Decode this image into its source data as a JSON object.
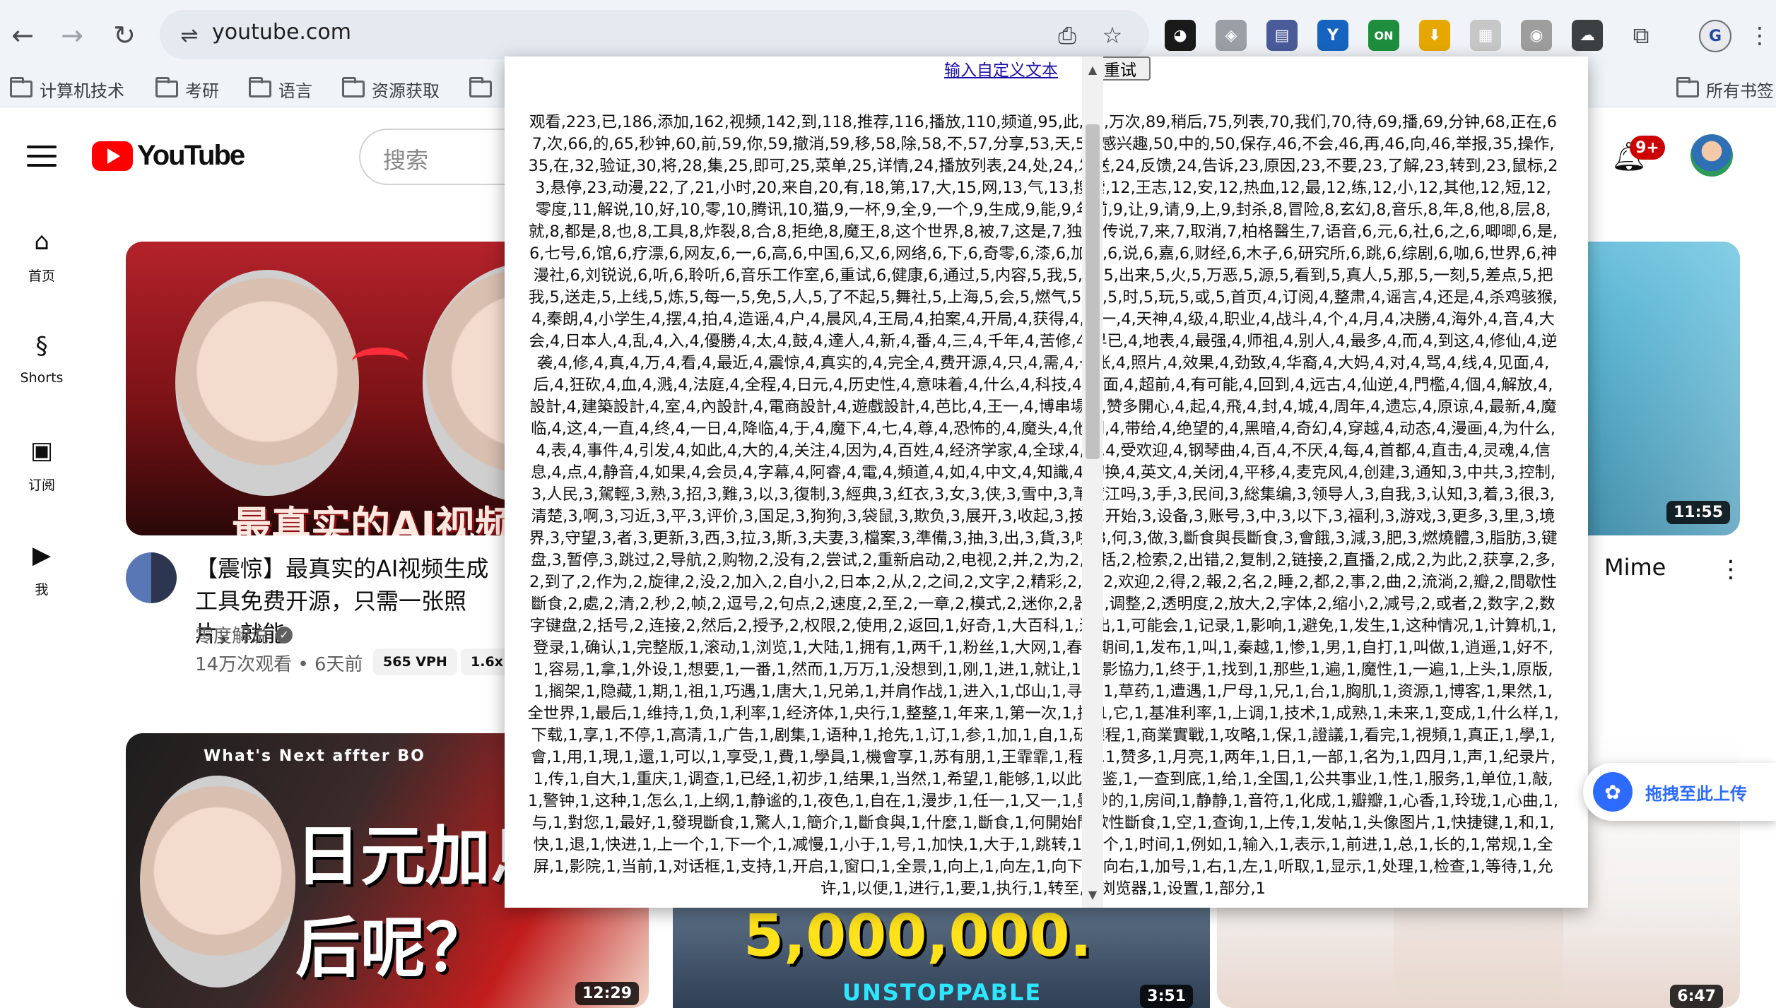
{
  "browser": {
    "url": "youtube.com",
    "bookmarks": [
      "计算机技术",
      "考研",
      "语言",
      "资源获取",
      "",
      "所有书签"
    ],
    "profile_initial": "G",
    "icons": {
      "back": "←",
      "forward": "→",
      "reload": "↻",
      "site_settings": "⇌",
      "install": "⎙",
      "star": "☆",
      "extensions": "⧉",
      "more": "⋮"
    },
    "extensions": [
      {
        "name": "ext-mask",
        "glyph": "◕",
        "color": "#1a1a1a"
      },
      {
        "name": "ext-shield",
        "glyph": "◈",
        "color": "#9aa0a6"
      },
      {
        "name": "ext-window",
        "glyph": "▤",
        "color": "#4a5b9a"
      },
      {
        "name": "ext-y",
        "glyph": "Y",
        "color": "#1664c0"
      },
      {
        "name": "ext-on",
        "glyph": "ON",
        "color": "#1e8e3e"
      },
      {
        "name": "ext-download",
        "glyph": "⬇",
        "color": "#e6a800"
      },
      {
        "name": "ext-grid",
        "glyph": "▦",
        "color": "#c7c7c7"
      },
      {
        "name": "ext-camera",
        "glyph": "◉",
        "color": "#9e9e9e"
      },
      {
        "name": "ext-cloud",
        "glyph": "☁",
        "color": "#3c4043"
      }
    ]
  },
  "youtube": {
    "logo": "YouTube",
    "search_placeholder": "搜索",
    "notifications_badge": "9+",
    "sidebar": [
      {
        "icon": "⌂",
        "label": "首页"
      },
      {
        "icon": "§",
        "label": "Shorts"
      },
      {
        "icon": "▣",
        "label": "订阅"
      },
      {
        "icon": "▶",
        "label": "我"
      }
    ],
    "videos": [
      {
        "thumb_text": "最真实的AI视频",
        "title": "【震惊】最真实的AI视频生成工具免费开源，只需一张照片，就能",
        "channel": "零度解说",
        "meta": "14万次观看 • 6天前",
        "chips": [
          "565 VPH",
          "1.6x"
        ],
        "duration": ""
      },
      {
        "thumb_text": "What's Next affter BO",
        "thumb_title": "日元加息然后呢？",
        "duration": "12:29"
      },
      {
        "thumb_text": "5,000,000.",
        "thumb_sub": "UNSTOPPABLE",
        "duration": "3:51"
      },
      {
        "title_fragment": "Mime",
        "duration": "11:55"
      },
      {
        "duration": "6:47"
      }
    ]
  },
  "popup": {
    "link": "输入自定义文本",
    "retry": "重试",
    "word_frequencies": "观看,223,已,186,添加,162,视频,142,到,118,推荐,116,播放,110,频道,95,此,92,万次,89,稍后,75,列表,70,我们,70,待,69,播,69,分钟,68,正在,67,次,66,的,65,秒钟,60,前,59,你,59,撤消,59,移,58,除,58,不,57,分享,53,天,51,感兴趣,50,中的,50,保存,46,不会,46,再,46,向,46,举报,35,操作,35,在,32,验证,30,将,28,集,25,即可,25,菜单,25,详情,24,播放列表,24,处,24,发送,24,反馈,24,告诉,23,原因,23,不要,23,了解,23,转到,23,鼠标,23,悬停,23,动漫,22,了,21,小时,20,来自,20,有,18,第,17,大,15,网,13,气,13,搜索,12,王志,12,安,12,热血,12,最,12,练,12,小,12,其他,12,短,12,零度,11,解说,10,好,10,零,10,腾讯,10,猫,9,一杯,9,全,9,一个,9,生成,9,能,9,年前,9,让,9,请,9,上,9,封杀,8,冒险,8,玄幻,8,音乐,8,年,8,他,8,层,8,就,8,都是,8,也,8,工具,8,炸裂,8,合,8,拒绝,8,魔王,8,这个世界,8,被,7,这是,7,独,7,传说,7,来,7,取消,7,柏格醫生,7,语音,6,元,6,社,6,之,6,唧唧,6,是,6,七号,6,馆,6,疗漂,6,网友,6,一,6,高,6,中国,6,又,6,网络,6,下,6,奇零,6,漆,6,加息,6,说,6,嘉,6,财经,6,木子,6,研究所,6,跳,6,综剧,6,咖,6,世界,6,神漫社,6,刘锐说,6,听,6,聆听,6,音乐工作室,6,重试,6,健康,6,通过,5,内容,5,我,5,红,5,出来,5,火,5,万恶,5,源,5,看到,5,真人,5,那,5,一刻,5,差点,5,把我,5,送走,5,上线,5,炼,5,每一,5,免,5,人,5,了不起,5,舞社,5,上海,5,会,5,燃气,5,老,5,时,5,玩,5,或,5,首页,4,订阅,4,整肃,4,谣言,4,还是,4,杀鸡骇猴,4,秦朗,4,小学生,4,摆,4,拍,4,造谣,4,户,4,晨风,4,王局,4,拍案,4,开局,4,获得,4,唯一,4,天神,4,级,4,职业,4,战斗,4,个,4,月,4,决勝,4,海外,4,音,4,大会,4,日本人,4,乱,4,入,4,優勝,4,太,4,鼓,4,達人,4,新,4,番,4,三,4,千年,4,苦修,4,早已,4,地表,4,最强,4,师祖,4,别人,4,最多,4,而,4,到这,4,修仙,4,逆袭,4,修,4,真,4,万,4,看,4,最近,4,震惊,4,真实的,4,完全,4,费开源,4,只,4,需,4,一张,4,照片,4,效果,4,劲致,4,华裔,4,大妈,4,对,4,骂,4,线,4,见面,4,后,4,狂砍,4,血,4,溅,4,法庭,4,全程,4,日元,4,历史性,4,意味着,4,什么,4,科技,4,层面,4,超前,4,有可能,4,回到,4,远古,4,仙逆,4,門檻,4,個,4,解放,4,設計,4,建築設計,4,室,4,內設計,4,電商設計,4,遊戲設計,4,芭比,4,王一,4,博串場,4,赞多開心,4,起,4,飛,4,封,4,城,4,周年,4,遗忘,4,原谅,4,最新,4,魔临,4,这,4,一直,4,终,4,一日,4,降临,4,于,4,魔下,4,七,4,尊,4,恐怖的,4,魔头,4,他们,4,带给,4,绝望的,4,黑暗,4,奇幻,4,穿越,4,动态,4,漫画,4,为什么,4,表,4,事件,4,引发,4,如此,4,大的,4,关注,4,因为,4,百姓,4,经济学家,4,全球,4,十,4,受欢迎,4,钢琴曲,4,百,4,不厌,4,每,4,首都,4,直击,4,灵魂,4,信息,4,点,4,静音,4,如果,4,会员,4,字幕,4,阿睿,4,電,4,頻道,4,如,4,中文,4,知識,4,切换,4,英文,4,关闭,4,平移,4,麦克风,4,创建,3,通知,3,中共,3,控制,3,人民,3,駕輕,3,熟,3,招,3,難,3,以,3,復制,3,經典,3,红衣,3,女,3,侠,3,雪中,3,苇渡江吗,3,手,3,民间,3,総集编,3,领导人,3,自我,3,认知,3,着,3,很,3,清楚,3,啊,3,习近,3,平,3,评价,3,国足,3,狗狗,3,袋鼠,3,欺负,3,展开,3,收起,3,按,3,开始,3,设备,3,账号,3,中,3,以下,3,福利,3,游戏,3,更多,3,里,3,境界,3,守望,3,者,3,更新,3,西,3,拉,3,斯,3,夫妻,3,檔案,3,準備,3,抽,3,出,3,貨,3,啦,3,何,3,做,3,斷食與長斷食,3,會餓,3,減,3,肥,3,燃燒體,3,脂肪,3,键盘,3,暂停,3,跳过,2,导航,2,购物,2,没有,2,尝试,2,重新启动,2,电视,2,并,2,为,2,包括,2,检索,2,出错,2,复制,2,链接,2,直播,2,成,2,为此,2,获享,2,多,2,到了,2,作为,2,旋律,2,没,2,加入,2,自小,2,日本,2,从,2,之间,2,文字,2,精彩,2,元,2,欢迎,2,得,2,報,2,名,2,睡,2,都,2,事,2,曲,2,流淌,2,瓣,2,間歇性斷食,2,處,2,清,2,秒,2,帧,2,逗号,2,句点,2,速度,2,至,2,一章,2,模式,2,迷你,2,器,2,调整,2,透明度,2,放大,2,字体,2,缩小,2,减号,2,或者,2,数字,2,数字键盘,2,括号,2,连接,2,然后,2,授予,2,权限,2,使用,2,返回,1,好奇,1,大百科,1,退出,1,可能会,1,记录,1,影响,1,避免,1,发生,1,这种情况,1,计算机,1,登录,1,确认,1,完整版,1,滚动,1,浏览,1,大陆,1,拥有,1,两千,1,粉丝,1,大网,1,春节期间,1,发布,1,叫,1,秦越,1,惨,1,男,1,自打,1,叫做,1,逍遥,1,好不,1,容易,1,拿,1,外设,1,想要,1,一番,1,然而,1,万万,1,没想到,1,刚,1,进,1,就让,1,摄影協力,1,终于,1,找到,1,那些,1,遍,1,魔性,1,一遍,1,上头,1,原版,1,搁架,1,隐藏,1,期,1,祖,1,巧遇,1,唐大,1,兄弟,1,并肩作战,1,进入,1,邙山,1,寻找,1,草药,1,遭遇,1,尸母,1,兄,1,台,1,胸肌,1,资源,1,博客,1,果然,1,全世界,1,最后,1,维持,1,负,1,利率,1,经济体,1,央行,1,整整,1,年来,1,第一次,1,把,1,它,1,基准利率,1,上调,1,技术,1,成熟,1,未来,1,变成,1,什么样,1,下载,1,享,1,不停,1,高清,1,广告,1,剧集,1,语种,1,抢先,1,订,1,参,1,加,1,自,1,研課程,1,商業實戰,1,攻略,1,保,1,證議,1,看完,1,視頻,1,真正,1,學,1,會,1,用,1,現,1,還,1,可以,1,享受,1,費,1,學員,1,機會享,1,苏有朋,1,王霏霏,1,程潇,1,赞多,1,月亮,1,两年,1,日,1,一部,1,名为,1,四月,1,声,1,纪录片,1,传,1,自大,1,重庆,1,调查,1,已经,1,初步,1,结果,1,当然,1,希望,1,能够,1,以此,1,鉴,1,一查到底,1,给,1,全国,1,公共事业,1,性,1,服务,1,单位,1,敲,1,警钟,1,这种,1,怎么,1,上纲,1,静谧的,1,夜色,1,自在,1,漫步,1,任一,1,又一,1,曼妙的,1,房间,1,静静,1,音符,1,化成,1,瓣瓣,1,心香,1,玲珑,1,心曲,1,与,1,對您,1,最好,1,發現斷食,1,驚人,1,簡介,1,斷食與,1,什麼,1,斷食,1,何開始間歇性斷食,1,空,1,查询,1,上传,1,发帖,1,头像图片,1,快捷键,1,和,1,快,1,退,1,快进,1,上一个,1,下一个,1,减慢,1,小于,1,号,1,加快,1,大于,1,跳转,1,某个,1,时间,1,例如,1,输入,1,表示,1,前进,1,总,1,长的,1,常规,1,全屏,1,影院,1,当前,1,对话框,1,支持,1,开启,1,窗口,1,全景,1,向上,1,向左,1,向下,1,向右,1,加号,1,右,1,左,1,听取,1,显示,1,处理,1,检查,1,等待,1,允许,1,以便,1,进行,1,要,1,执行,1,转至,1,浏览器,1,设置,1,部分,1"
  },
  "upload_widget": {
    "label": "拖拽至此上传",
    "icon": "✿"
  }
}
